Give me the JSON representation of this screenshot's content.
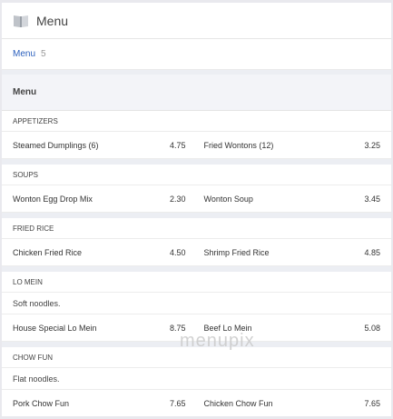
{
  "header": {
    "title": "Menu"
  },
  "breadcrumb": {
    "label": "Menu",
    "count": "5"
  },
  "section": {
    "title": "Menu"
  },
  "categories": [
    {
      "name": "APPETIZERS",
      "description": "",
      "items": [
        {
          "name": "Steamed Dumplings (6)",
          "price": "4.75"
        },
        {
          "name": "Fried Wontons (12)",
          "price": "3.25"
        }
      ]
    },
    {
      "name": "SOUPS",
      "description": "",
      "items": [
        {
          "name": "Wonton Egg Drop Mix",
          "price": "2.30"
        },
        {
          "name": "Wonton Soup",
          "price": "3.45"
        }
      ]
    },
    {
      "name": "FRIED RICE",
      "description": "",
      "items": [
        {
          "name": "Chicken Fried Rice",
          "price": "4.50"
        },
        {
          "name": "Shrimp Fried Rice",
          "price": "4.85"
        }
      ]
    },
    {
      "name": "LO MEIN",
      "description": "Soft noodles.",
      "items": [
        {
          "name": "House Special Lo Mein",
          "price": "8.75"
        },
        {
          "name": "Beef Lo Mein",
          "price": "5.08"
        }
      ]
    },
    {
      "name": "CHOW FUN",
      "description": "Flat noodles.",
      "items": [
        {
          "name": "Pork Chow Fun",
          "price": "7.65"
        },
        {
          "name": "Chicken Chow Fun",
          "price": "7.65"
        }
      ]
    }
  ],
  "watermark": "menupix",
  "icons": {
    "header": "book-icon"
  },
  "colors": {
    "link": "#2a5fbd",
    "page_bg": "#e9e9ee",
    "section_bg": "#f3f4f8"
  }
}
